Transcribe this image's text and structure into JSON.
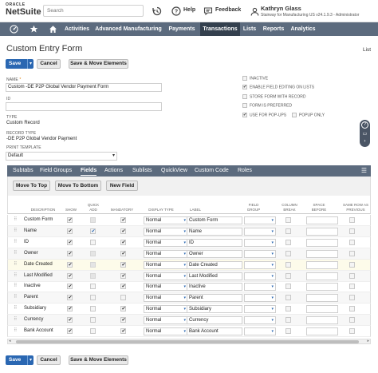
{
  "topbar": {
    "logo_top": "ORACLE",
    "logo_bottom": "NetSuite",
    "search_placeholder": "Search",
    "help_label": "Help",
    "feedback_label": "Feedback",
    "user_name": "Kathryn Glass",
    "user_role": "Stairway for Manufacturing US v24.1.9.3 - Administrator"
  },
  "nav": {
    "items": [
      "Activities",
      "Advanced Manufacturing",
      "Payments",
      "Transactions",
      "Lists",
      "Reports",
      "Analytics"
    ],
    "active": "Transactions"
  },
  "page": {
    "title": "Custom Entry Form",
    "list_link": "List"
  },
  "buttons": {
    "save": "Save",
    "cancel": "Cancel",
    "save_move": "Save & Move Elements"
  },
  "form": {
    "name_label": "NAME",
    "name_value": "Custom -DE P2P Global Vendor Payment Form",
    "id_label": "ID",
    "id_value": "",
    "type_label": "TYPE",
    "type_value": "Custom Record",
    "record_type_label": "RECORD TYPE",
    "record_type_value": "-DE P2P Global Vendor Payment",
    "print_template_label": "PRINT TEMPLATE",
    "print_template_value": "Default",
    "checkboxes": {
      "inactive": {
        "label": "INACTIVE",
        "checked": false
      },
      "enable_field_editing": {
        "label": "ENABLE FIELD EDITING ON LISTS",
        "checked": true
      },
      "store_form": {
        "label": "STORE FORM WITH RECORD",
        "checked": false
      },
      "form_preferred": {
        "label": "FORM IS PREFERRED",
        "checked": false
      },
      "use_popups": {
        "label": "USE FOR POP-UPS",
        "checked": true
      },
      "popup_only": {
        "label": "POPUP ONLY",
        "checked": false
      }
    }
  },
  "subtabs": {
    "items": [
      "Subtabs",
      "Field Groups",
      "Fields",
      "Actions",
      "Sublists",
      "QuickView",
      "Custom Code",
      "Roles"
    ],
    "active": "Fields"
  },
  "toolbar": {
    "move_top": "Move To Top",
    "move_bottom": "Move To Bottom",
    "new_field": "New Field"
  },
  "table": {
    "headers": {
      "description": "DESCRIPTION",
      "show": "SHOW",
      "quick_add": "QUICK ADD",
      "mandatory": "MANDATORY",
      "display_type": "DISPLAY TYPE",
      "label": "LABEL",
      "field_group": "FIELD GROUP",
      "column_break": "COLUMN BREAK",
      "space_before": "SPACE BEFORE",
      "same_row": "SAME ROW AS PREVIOUS"
    },
    "rows": [
      {
        "description": "Custom Form",
        "show": true,
        "quick_add": false,
        "quick_add_disabled": true,
        "mandatory": true,
        "display_type": "Normal",
        "label": "Custom Form"
      },
      {
        "description": "Name",
        "show": true,
        "quick_add": true,
        "quick_add_disabled": false,
        "mandatory": true,
        "display_type": "Normal",
        "label": "Name"
      },
      {
        "description": "ID",
        "show": true,
        "quick_add": false,
        "quick_add_disabled": false,
        "mandatory": true,
        "display_type": "Normal",
        "label": "ID"
      },
      {
        "description": "Owner",
        "show": true,
        "quick_add": false,
        "quick_add_disabled": true,
        "mandatory": true,
        "display_type": "Normal",
        "label": "Owner"
      },
      {
        "description": "Date Created",
        "show": true,
        "quick_add": false,
        "quick_add_disabled": true,
        "mandatory": true,
        "display_type": "Normal",
        "label": "Date Created"
      },
      {
        "description": "Last Modified",
        "show": true,
        "quick_add": false,
        "quick_add_disabled": true,
        "mandatory": true,
        "display_type": "Normal",
        "label": "Last Modified"
      },
      {
        "description": "Inactive",
        "show": true,
        "quick_add": false,
        "quick_add_disabled": false,
        "mandatory": true,
        "display_type": "Normal",
        "label": "Inactive"
      },
      {
        "description": "Parent",
        "show": true,
        "quick_add": false,
        "quick_add_disabled": false,
        "mandatory": false,
        "display_type": "Normal",
        "label": "Parent"
      },
      {
        "description": "Subsidiary",
        "show": true,
        "quick_add": false,
        "quick_add_disabled": false,
        "mandatory": true,
        "display_type": "Normal",
        "label": "Subsidiary"
      },
      {
        "description": "Currency",
        "show": true,
        "quick_add": false,
        "quick_add_disabled": false,
        "mandatory": true,
        "display_type": "Normal",
        "label": "Currency"
      },
      {
        "description": "Bank Account",
        "show": true,
        "quick_add": false,
        "quick_add_disabled": false,
        "mandatory": true,
        "display_type": "Normal",
        "label": "Bank Account"
      }
    ]
  },
  "colors": {
    "nav_bg": "#5c6b7e",
    "nav_active": "#34404e",
    "primary": "#2a67b2",
    "required": "#e07b00"
  },
  "icons": [
    "history-icon",
    "help-icon",
    "feedback-icon",
    "user-icon",
    "home-icon",
    "star-icon",
    "house-icon",
    "menu-icon"
  ]
}
